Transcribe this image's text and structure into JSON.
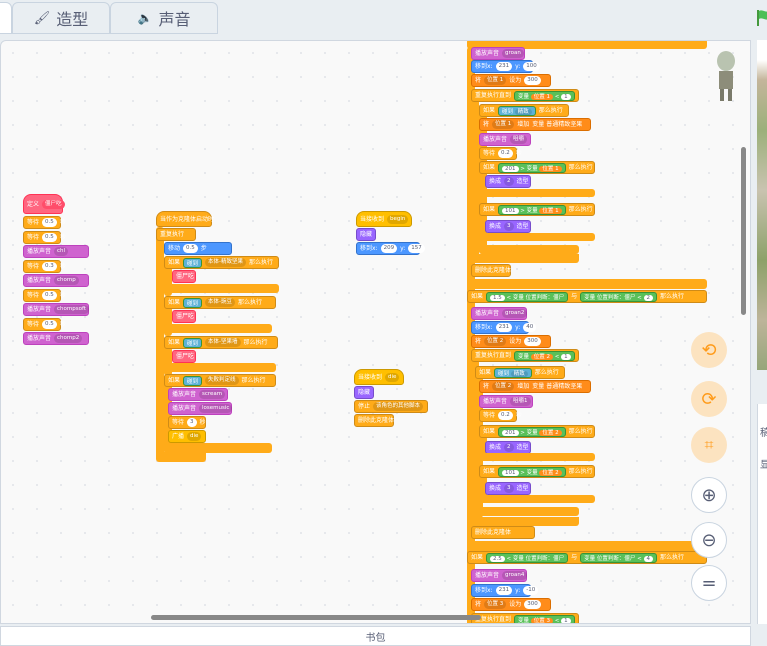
{
  "tabs": {
    "costume": "造型",
    "sound": "声音"
  },
  "icons": {
    "brush": "brush-icon",
    "speaker": "speaker-icon",
    "flag": "green-flag-icon"
  },
  "backpack": "书包",
  "right_panel": {
    "text1": "稿",
    "text2": "显"
  },
  "scripts": {
    "s1": {
      "define": "定义",
      "define_arg": "僵尸吃",
      "wait": "等待",
      "secs": "秒",
      "play": "播放声音",
      "items": [
        {
          "t": "w",
          "v": "0.5"
        },
        {
          "t": "w",
          "v": "0.5"
        },
        {
          "t": "s",
          "v": "chl"
        },
        {
          "t": "w",
          "v": "0.3"
        },
        {
          "t": "s",
          "v": "chomp"
        },
        {
          "t": "w",
          "v": "0.5"
        },
        {
          "t": "s",
          "v": "chompsoft"
        },
        {
          "t": "w",
          "v": "0.5"
        },
        {
          "t": "s",
          "v": "chomp2"
        }
      ]
    },
    "s2": {
      "hat": "当作为克隆体启动时",
      "forever": "重复执行",
      "move": "移动",
      "move_v": "0.5",
      "steps": "步",
      "if": "如果",
      "touch": "碰到",
      "then": "那么执行",
      "call": "僵尸吃",
      "t1": "本体-精致坚果",
      "t2": "本体-豌豆",
      "t3": "本体-坚果墙",
      "t4": "失败判定线",
      "play": "播放声音",
      "snd1": "scream",
      "snd2": "losemusic",
      "wait": "等待",
      "wait_v": "3",
      "secs": "秒",
      "bcast": "广播",
      "bcast_v": "die"
    },
    "s3": {
      "hat": "当接收到",
      "msg": "begin",
      "hide": "隐藏",
      "goto": "移到x:",
      "x": "209",
      "y_label": "y:",
      "y": "157"
    },
    "s4": {
      "hat": "当接收到",
      "msg": "die",
      "hide": "隐藏",
      "stop": "停止",
      "stop_v": "该角色的其他脚本",
      "del": "删除此克隆体"
    },
    "s5": {
      "play": "播放声音",
      "snd_a": "groan",
      "snd_b": "groan2",
      "snd_c": "groan4",
      "goto": "移到x:",
      "gx": "231",
      "y_label": "y:",
      "gy1": "100",
      "gy2": "40",
      "gy3": "-10",
      "set": "将",
      "var1": "位置 1",
      "var2": "位置 2",
      "var3": "位置 3",
      "set_to": "设为",
      "set_v": "300",
      "repeat_until": "重复执行直到",
      "var_label": "变量",
      "lt": "<",
      "gt": ">",
      "one": "1",
      "if": "如果",
      "touch": "碰到",
      "target": "精致",
      "then": "那么执行",
      "incr": "增加",
      "incr_label": "变量 普通精致坚果",
      "snd_d": "咀嚼",
      "snd_e": "咀嚼1",
      "wait": "等待",
      "wait_v": "0.2",
      "secs": "秒",
      "v201": "201",
      "v101": "101",
      "switch": "换成",
      "cost2": "2",
      "cost3": "3",
      "costume": "造型",
      "del": "删除此克隆体",
      "cond_var": "变量 位置判断：僵尸",
      "and": "与",
      "c1": "1.5",
      "c2": "2",
      "c3": "2.5",
      "c4": "4"
    }
  }
}
